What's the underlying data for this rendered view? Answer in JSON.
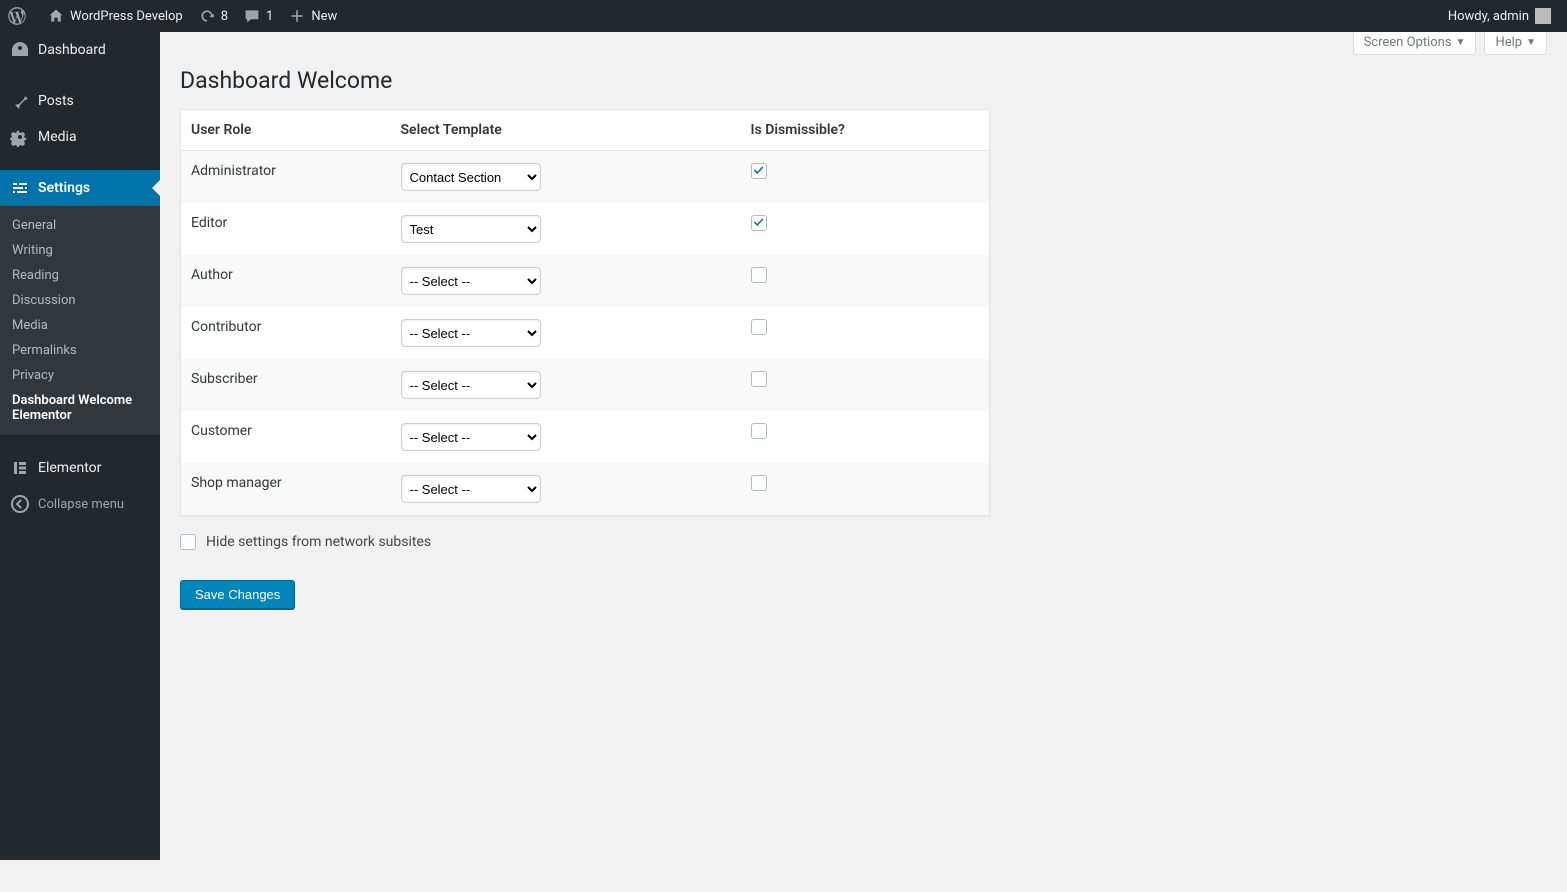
{
  "adminbar": {
    "site_name": "WordPress Develop",
    "updates_count": "8",
    "comments_count": "1",
    "new_label": "New",
    "howdy": "Howdy, admin"
  },
  "sidebar": {
    "dashboard": "Dashboard",
    "posts": "Posts",
    "media": "Media",
    "settings": "Settings",
    "submenu": {
      "general": "General",
      "writing": "Writing",
      "reading": "Reading",
      "discussion": "Discussion",
      "media": "Media",
      "permalinks": "Permalinks",
      "privacy": "Privacy",
      "dw_elementor": "Dashboard Welcome Elementor"
    },
    "elementor": "Elementor",
    "collapse": "Collapse menu"
  },
  "screen_help": {
    "screen_options": "Screen Options",
    "help": "Help"
  },
  "page_title": "Dashboard Welcome",
  "table": {
    "headers": {
      "role": "User Role",
      "template": "Select Template",
      "dismissible": "Is Dismissible?"
    },
    "select_placeholder": "-- Select --",
    "rows": [
      {
        "role": "Administrator",
        "template": "Contact Section",
        "dismissible": true
      },
      {
        "role": "Editor",
        "template": "Test",
        "dismissible": true
      },
      {
        "role": "Author",
        "template": "",
        "dismissible": false
      },
      {
        "role": "Contributor",
        "template": "",
        "dismissible": false
      },
      {
        "role": "Subscriber",
        "template": "",
        "dismissible": false
      },
      {
        "role": "Customer",
        "template": "",
        "dismissible": false
      },
      {
        "role": "Shop manager",
        "template": "",
        "dismissible": false
      }
    ]
  },
  "hide_label": "Hide settings from network subsites",
  "save_label": "Save Changes"
}
